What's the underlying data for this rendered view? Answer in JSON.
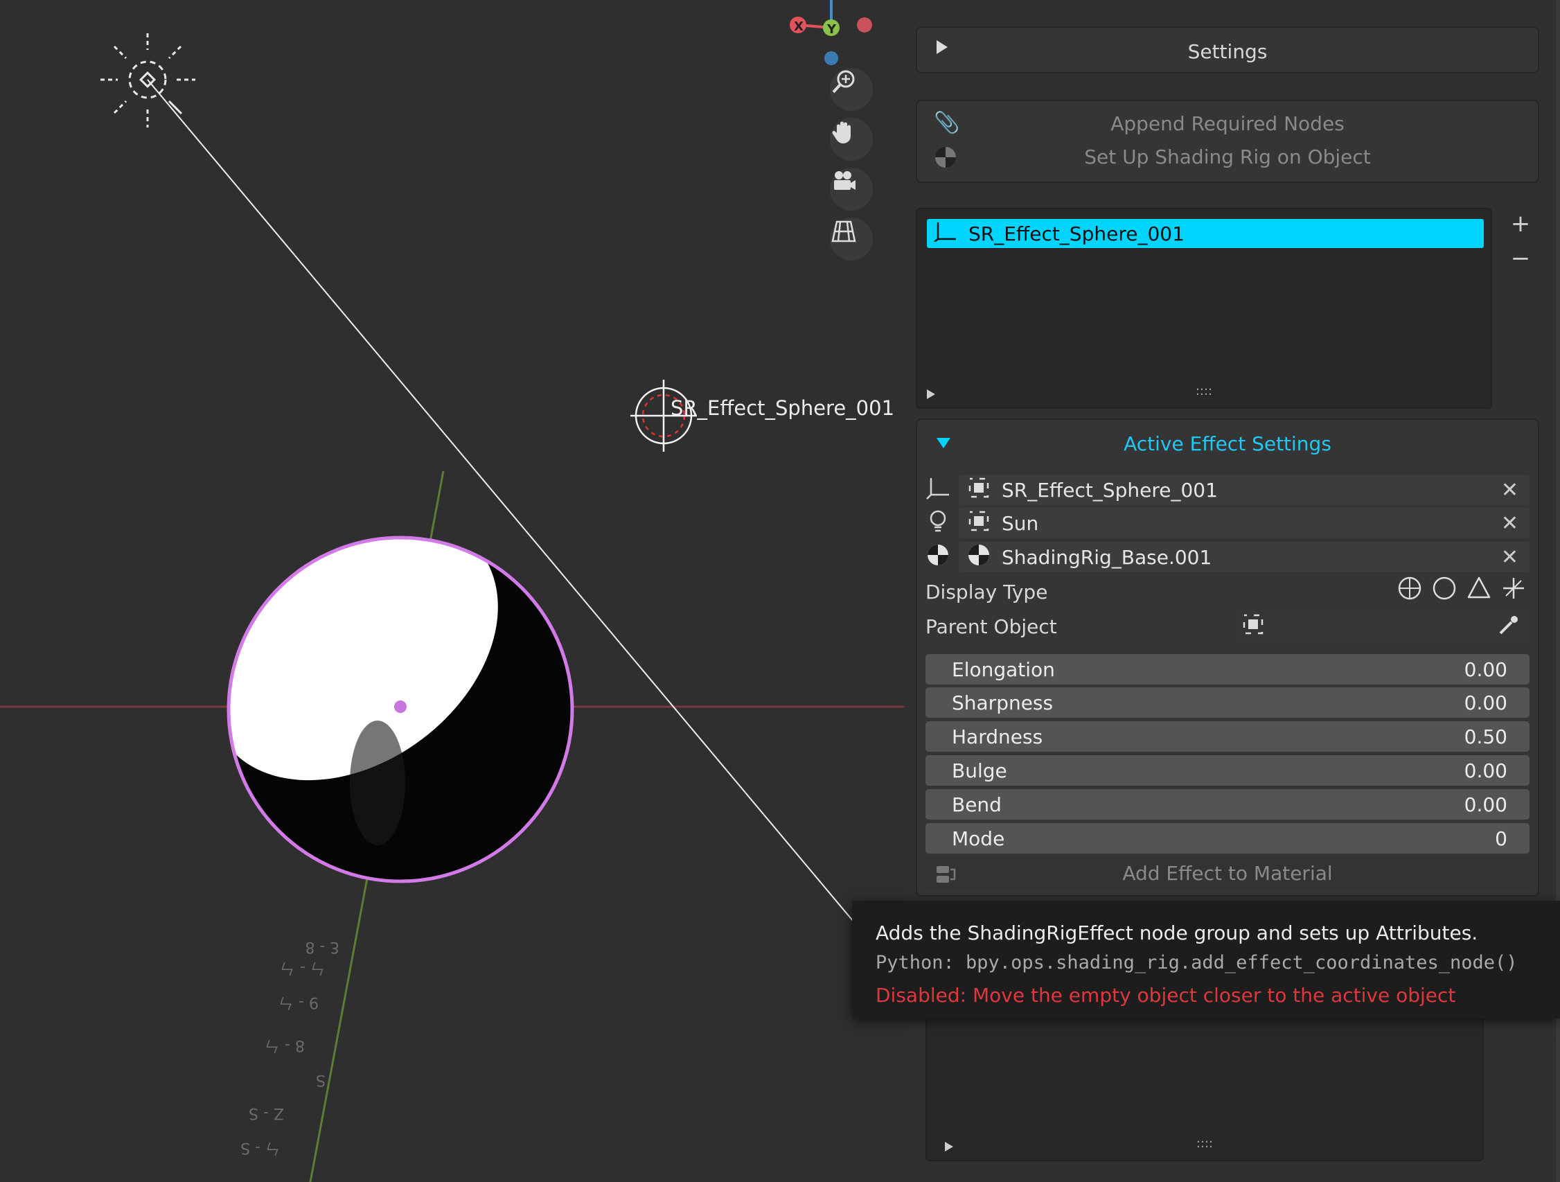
{
  "viewport": {
    "object_label": "SR_Effect_Sphere_001",
    "axis_labels": {
      "x": "X",
      "y": "Y"
    },
    "nav_icons": [
      "zoom-icon",
      "pan-hand-icon",
      "camera-icon",
      "grid-perspective-icon"
    ]
  },
  "panel": {
    "settings_label": "Settings",
    "append_nodes_label": "Append Required Nodes",
    "setup_rig_label": "Set Up Shading Rig on Object",
    "effects_list": {
      "items": [
        "SR_Effect_Sphere_001"
      ],
      "add_label": "+",
      "remove_label": "−",
      "grip": "::::"
    },
    "active_effect_header": "Active Effect Settings",
    "object_fields": [
      {
        "value": "SR_Effect_Sphere_001",
        "icon": "empty-axes-icon"
      },
      {
        "value": "Sun",
        "icon": "light-bulb-icon"
      },
      {
        "value": "ShadingRig_Base.001",
        "icon": "material-sphere-icon"
      }
    ],
    "display_type_label": "Display Type",
    "parent_object_label": "Parent Object",
    "sliders": [
      {
        "label": "Elongation",
        "value": "0.00"
      },
      {
        "label": "Sharpness",
        "value": "0.00"
      },
      {
        "label": "Hardness",
        "value": "0.50"
      },
      {
        "label": "Bulge",
        "value": "0.00"
      },
      {
        "label": "Bend",
        "value": "0.00"
      },
      {
        "label": "Mode",
        "value": "0"
      }
    ],
    "add_effect_label": "Add Effect to Material",
    "second_list_grip": "::::"
  },
  "tooltip": {
    "description": "Adds the ShadingRigEffect node group and sets up Attributes.",
    "python": "Python: bpy.ops.shading_rig.add_effect_coordinates_node()",
    "disabled": "Disabled: Move the empty object closer to the active object"
  },
  "colors": {
    "accent_cyan": "#00d4ff",
    "selection_pink": "#d27be8",
    "error_red": "#e0373e",
    "x_axis": "#e0525c",
    "y_axis": "#8bc34a",
    "z_axis": "#3e8fd6"
  }
}
